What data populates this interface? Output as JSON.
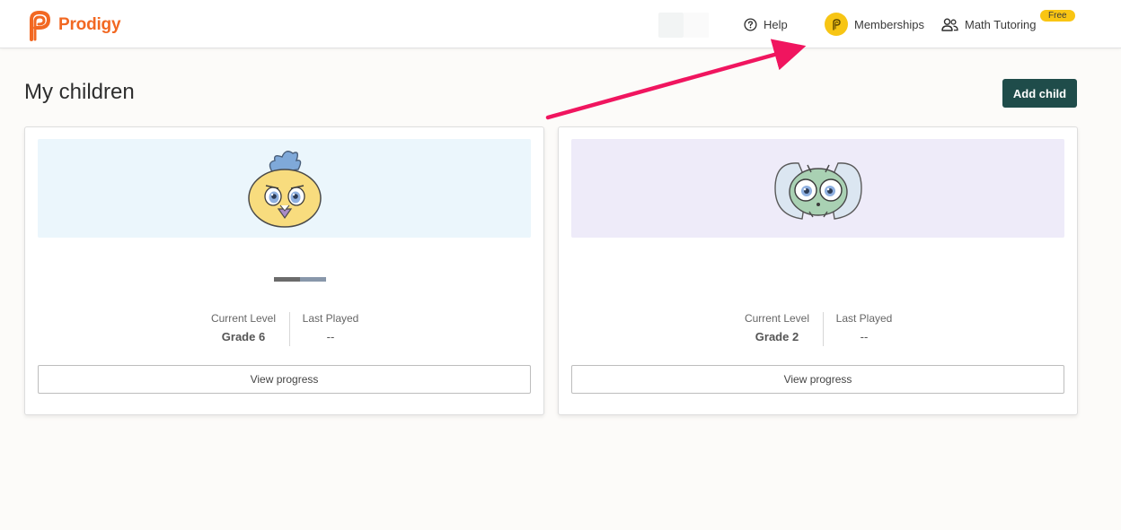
{
  "header": {
    "brand": "Prodigy",
    "nav": {
      "help": "Help",
      "memberships": "Memberships",
      "math_tutoring": "Math Tutoring",
      "free_badge": "Free"
    }
  },
  "main": {
    "title": "My children",
    "add_child": "Add child",
    "children": [
      {
        "avatar_icon": "chick-avatar-icon",
        "current_level_label": "Current Level",
        "current_level": "Grade 6",
        "last_played_label": "Last Played",
        "last_played": "--",
        "view_progress": "View progress"
      },
      {
        "avatar_icon": "bug-avatar-icon",
        "current_level_label": "Current Level",
        "current_level": "Grade 2",
        "last_played_label": "Last Played",
        "last_played": "--",
        "view_progress": "View progress"
      }
    ]
  },
  "colors": {
    "brand_orange": "#f26822",
    "primary_button": "#1f4c4a",
    "membership_yellow": "#f7c514",
    "annotation_arrow": "#f0155f"
  }
}
